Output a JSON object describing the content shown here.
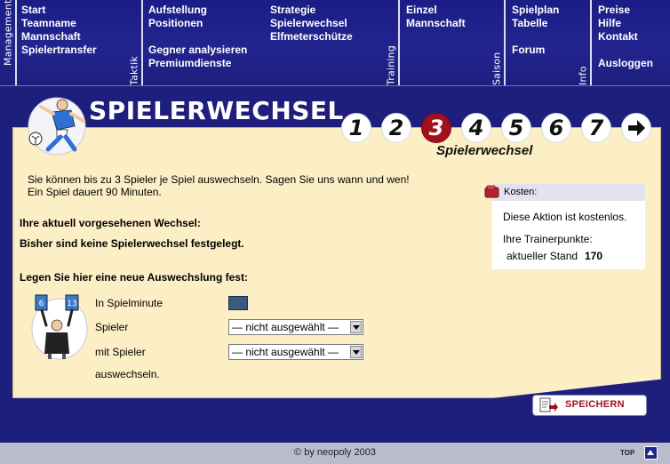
{
  "nav": {
    "sections": [
      {
        "label": "Management",
        "links": [
          "Start",
          "Teamname",
          "Mannschaft",
          "Spielertransfer"
        ]
      },
      {
        "label": "Taktik",
        "links": [
          "Aufstellung",
          "Positionen",
          "",
          "Gegner analysieren",
          "Premiumdienste"
        ]
      },
      {
        "label": "Training",
        "links": [
          "Strategie",
          "Spielerwechsel",
          "Elfmeterschütze"
        ]
      },
      {
        "label": "Saison",
        "links": [
          "Einzel",
          "Mannschaft"
        ]
      },
      {
        "label": "Info",
        "links": [
          "Spielplan",
          "Tabelle",
          "",
          "Forum"
        ]
      },
      {
        "label": "",
        "links": [
          "Preise",
          "Hilfe",
          "Kontakt",
          "",
          "Ausloggen"
        ]
      }
    ]
  },
  "page_title": "SPIELERWECHSEL",
  "steps": {
    "items": [
      "1",
      "2",
      "3",
      "4",
      "5",
      "6",
      "7"
    ],
    "active": "3",
    "next_icon": "arrow-right-icon",
    "current_title": "Spielerwechsel"
  },
  "intro": {
    "line1": "Sie können bis zu 3 Spieler je Spiel auswechseln. Sagen Sie uns wann und wen!",
    "line2": "Ein Spiel dauert 90 Minuten."
  },
  "current_subs": {
    "heading": "Ihre aktuell vorgesehenen Wechsel:",
    "status": "Bisher sind keine Spielerwechsel festgelegt."
  },
  "cost_box": {
    "title": "Kosten:",
    "free_text": "Diese Aktion ist kostenlos.",
    "points_label": "Ihre Trainerpunkte:",
    "current_label": "aktueller Stand",
    "current_value": "170"
  },
  "form": {
    "heading": "Legen Sie hier eine neue Auswechslung fest:",
    "minute_label": "In Spielminute",
    "minute_value": "",
    "player_label": "Spieler",
    "player_selected": "— nicht ausgewählt —",
    "with_label": "mit Spieler",
    "with_selected": "— nicht ausgewählt —",
    "suffix": "auswechseln."
  },
  "save_label": "SPEICHERN",
  "footer": {
    "copyright": "© by neopoly 2003",
    "top_label": "TOP"
  },
  "colors": {
    "background": "#1e1f7c",
    "panel": "#fcefc6",
    "accent_red": "#a30f1b",
    "nav": "#1b1d86"
  }
}
